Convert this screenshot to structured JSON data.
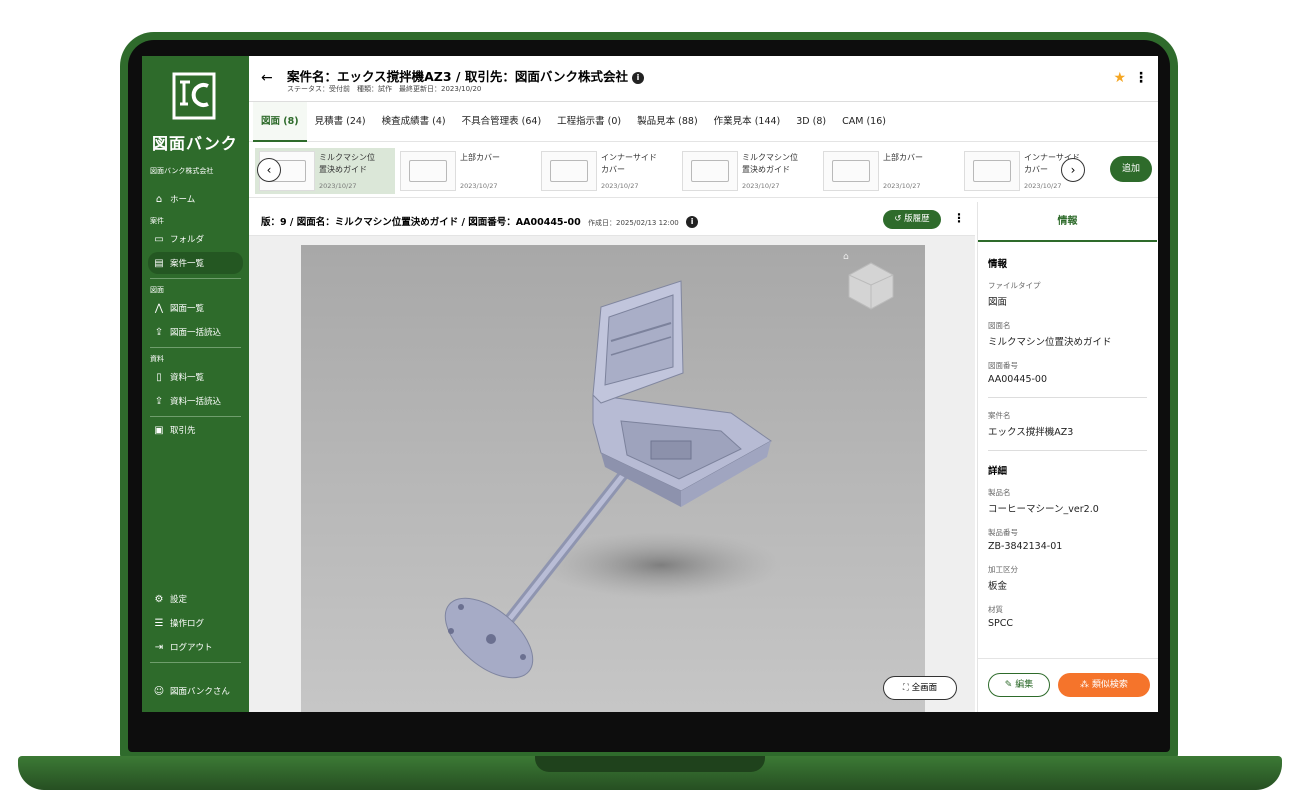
{
  "brand": {
    "logo_text": "図面バンク",
    "company": "図面バンク株式会社",
    "color": "#2e6b2b",
    "device_color": "#2f6b2c"
  },
  "sidebar": {
    "home": "ホーム",
    "section_case": "案件",
    "folder": "フォルダ",
    "case_list": "案件一覧",
    "section_drawing": "図面",
    "drawing_list": "図面一覧",
    "drawing_bulk": "図面一括読込",
    "section_docs": "資料",
    "docs_list": "資料一覧",
    "docs_bulk": "資料一括読込",
    "clients": "取引先",
    "settings": "設定",
    "log": "操作ログ",
    "logout": "ログアウト",
    "user": "図面バンクさん"
  },
  "header": {
    "title": "案件名：エックス撹拌機AZ3 / 取引先：図面バンク株式会社",
    "subtitle": "ステータス：受付前　種類：試作　最終更新日：2023/10/20"
  },
  "tabs": [
    {
      "label": "図面 (8)"
    },
    {
      "label": "見積書 (24)"
    },
    {
      "label": "検査成績書 (4)"
    },
    {
      "label": "不具合管理表 (64)"
    },
    {
      "label": "工程指示書 (0)"
    },
    {
      "label": "製品見本 (88)"
    },
    {
      "label": "作業見本 (144)"
    },
    {
      "label": "3D (8)"
    },
    {
      "label": "CAM (16)"
    }
  ],
  "thumbnails": [
    {
      "line1": "ミルクマシン位",
      "line2": "置決めガイド",
      "date": "2023/10/27"
    },
    {
      "line1": "上部カバー",
      "line2": "",
      "date": "2023/10/27"
    },
    {
      "line1": "インナーサイド",
      "line2": "カバー",
      "date": "2023/10/27"
    },
    {
      "line1": "ミルクマシン位",
      "line2": "置決めガイド",
      "date": "2023/10/27"
    },
    {
      "line1": "上部カバー",
      "line2": "",
      "date": "2023/10/27"
    },
    {
      "line1": "インナーサイド",
      "line2": "カバー",
      "date": "2023/10/27"
    }
  ],
  "add_label": "追加",
  "viewer": {
    "title": "版：9 / 図面名：ミルクマシン位置決めガイド / 図面番号：AA00445-00",
    "created": "作成日：2025/02/13 12:00",
    "history_label": "版履歴",
    "fullscreen_label": "全画面"
  },
  "panel": {
    "tab_label": "情報",
    "info_title": "情報",
    "file_type_label": "ファイルタイプ",
    "file_type": "図面",
    "drawing_name_label": "図面名",
    "drawing_name": "ミルクマシン位置決めガイド",
    "drawing_no_label": "図面番号",
    "drawing_no": "AA00445-00",
    "case_name_label": "案件名",
    "case_name": "エックス撹拌機AZ3",
    "detail_title": "詳細",
    "product_name_label": "製品名",
    "product_name": "コーヒーマシーン_ver2.0",
    "product_no_label": "製品番号",
    "product_no": "ZB-3842134-01",
    "process_label": "加工区分",
    "process": "板金",
    "material_label": "材質",
    "material": "SPCC",
    "edit_label": "編集",
    "similar_label": "類似検索",
    "similar_color": "#f5742b"
  }
}
